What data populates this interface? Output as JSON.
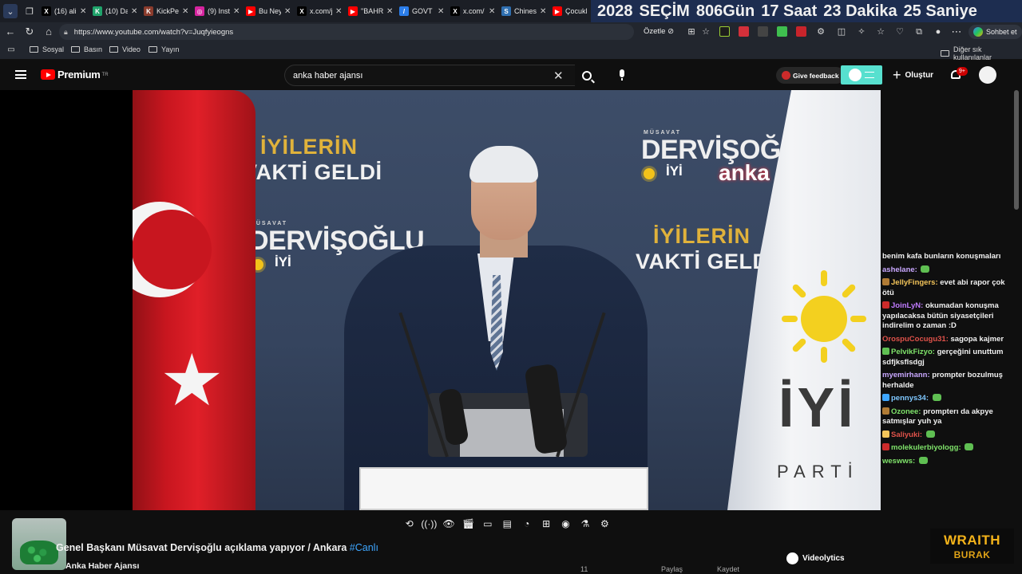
{
  "browser": {
    "tabs": [
      {
        "title": "(16) ali",
        "color": "#000000",
        "glyph": "X"
      },
      {
        "title": "(10) Da",
        "color": "#1fa36b",
        "glyph": "K"
      },
      {
        "title": "KickPe",
        "color": "#8a3b2c",
        "glyph": "K"
      },
      {
        "title": "(9) Inst",
        "color": "#d6249f",
        "glyph": "◎"
      },
      {
        "title": "Bu Ney",
        "color": "#ff0000",
        "glyph": "▶"
      },
      {
        "title": "x.com/j",
        "color": "#000000",
        "glyph": "X"
      },
      {
        "title": "\"BAHR",
        "color": "#ff0000",
        "glyph": "▶"
      },
      {
        "title": "GOVT",
        "color": "#2b7de9",
        "glyph": "/"
      },
      {
        "title": "x.com/",
        "color": "#000000",
        "glyph": "X"
      },
      {
        "title": "Chines",
        "color": "#2f6fb0",
        "glyph": "S"
      },
      {
        "title": "Çocukl",
        "color": "#ff0000",
        "glyph": "▶"
      }
    ],
    "countdown": {
      "year": "2028",
      "label": "SEÇİM",
      "days": "806Gün",
      "hours": "17 Saat",
      "minutes": "23 Dakika",
      "seconds": "25 Saniye"
    },
    "url": "https://www.youtube.com/watch?v=Juqfyieogns",
    "summarize_label": "Özetle",
    "chat_label": "Sohbet et",
    "bookmarks": [
      "Sosyal",
      "Basın",
      "Video",
      "Yayın"
    ],
    "other_bookmarks": "Diğer sık kullanılanlar",
    "icons": [
      "back-icon",
      "refresh-icon",
      "home-icon",
      "lock-icon",
      "star-icon",
      "extensions-icon",
      "favorites-icon",
      "more-icon"
    ]
  },
  "youtube": {
    "logo_text": "Premium",
    "logo_region": "TR",
    "search_value": "anka haber ajansı",
    "feedback_label": "Give feedback",
    "create_label": "Oluştur",
    "notification_count": "9+"
  },
  "video": {
    "backdrop": {
      "slogan_line1": "İYİLERİN",
      "slogan_line2": "VAKTİ GELDİ",
      "musavat": "MÜSAVAT",
      "dervisoglu": "DERVİŞOĞLU",
      "iyi": "İYİ",
      "anka": "anka"
    },
    "flag_text": {
      "iyi": "İYİ",
      "parti": "PARTİ"
    },
    "controls": [
      "loop-icon",
      "audio-wave-icon",
      "watch-icon",
      "clapper-icon",
      "crop-icon",
      "theater-icon",
      "speed-icon",
      "picture-in-picture-icon",
      "screenshot-icon",
      "lab-icon",
      "settings-icon"
    ],
    "title_main": "Genel Başkanı Müsavat Dervişoğlu açıklama yapıyor / Ankara",
    "title_tag": "#Canlı",
    "channel": "Anka Haber Ajansı",
    "videolytics_label": "Videolytics",
    "action_labels": [
      "11",
      "Paylaş",
      "Kaydet"
    ]
  },
  "chat": {
    "messages": [
      {
        "user": "",
        "user_color": "#ffffff",
        "badge": "",
        "text": "benim kafa bunların konuşmaları",
        "emote": false
      },
      {
        "user": "ashelane:",
        "user_color": "#c9a8ff",
        "badge": "",
        "text": "",
        "emote": true
      },
      {
        "user": "JellyFingers:",
        "user_color": "#f4c55a",
        "badge": "#b07b35",
        "text": "evet abi rapor çok ötü",
        "emote": false
      },
      {
        "user": "JoinLyN:",
        "user_color": "#c07bff",
        "badge": "#cc2b2b",
        "text": "okumadan konuşma yapılacaksa bütün siyasetçileri indirelim o zaman :D",
        "emote": false
      },
      {
        "user": "OrospuCocugu31:",
        "user_color": "#e0524a",
        "badge": "",
        "text": "sagopa kajmer",
        "emote": false
      },
      {
        "user": "PelvikFizyo:",
        "user_color": "#7fe36a",
        "badge": "#5fbf52",
        "text": "gerçeğini unuttum sdfjksflsdgj",
        "emote": false
      },
      {
        "user": "myemirhann:",
        "user_color": "#c9a8ff",
        "badge": "",
        "text": "prompter bozulmuş herhalde",
        "emote": false
      },
      {
        "user": "pennys34:",
        "user_color": "#7fc8ff",
        "badge": "#3ea6ff",
        "text": "",
        "emote": true
      },
      {
        "user": "Ozonee:",
        "user_color": "#7fe36a",
        "badge": "#b07b35",
        "text": "promptеrı da akpye satmışlar yuh ya",
        "emote": false
      },
      {
        "user": "Saliyuki:",
        "user_color": "#e0524a",
        "badge": "#f4c55a",
        "text": "",
        "emote": true
      },
      {
        "user": "molekulerbiyologg:",
        "user_color": "#7fe36a",
        "badge": "#cc2b2b",
        "text": "",
        "emote": true
      },
      {
        "user": "weswws:",
        "user_color": "#7fe36a",
        "badge": "",
        "text": "",
        "emote": true
      }
    ]
  },
  "overlay": {
    "line1": "WRAITH",
    "line2": "BURAK"
  }
}
